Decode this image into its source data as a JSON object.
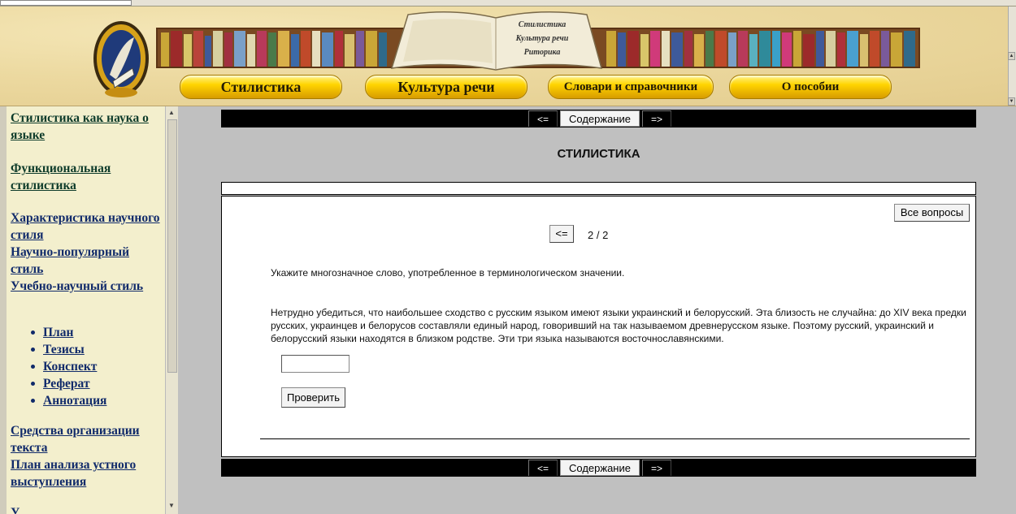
{
  "header": {
    "logo_alt": "Стилистика",
    "open_book_lines": [
      "Стилистика",
      "Культура речи",
      "Риторика"
    ],
    "nav": [
      {
        "label": "Стилистика"
      },
      {
        "label": "Культура речи"
      },
      {
        "label": "Словари и справочники"
      },
      {
        "label": "О пособии"
      }
    ]
  },
  "sidebar": {
    "links_top": [
      {
        "label": "Стилистика как наука о языке"
      },
      {
        "label": "Функциональная стилистика"
      },
      {
        "label": "Характеристика научного стиля"
      },
      {
        "label": "Научно-популярный стиль"
      },
      {
        "label": "Учебно-научный стиль"
      }
    ],
    "sublinks": [
      {
        "label": "План"
      },
      {
        "label": "Тезисы"
      },
      {
        "label": "Конспект"
      },
      {
        "label": "Реферат"
      },
      {
        "label": "Аннотация"
      }
    ],
    "links_bottom": [
      {
        "label": "Средства организации текста"
      },
      {
        "label": "План анализа устного выступления"
      }
    ]
  },
  "nav_bar": {
    "prev": "<=",
    "contents": "Содержание",
    "next": "=>"
  },
  "main": {
    "title": "СТИЛИСТИКА",
    "all_questions": "Все вопросы",
    "back": "<=",
    "counter": "2 / 2",
    "question": "Укажите многозначное слово, употребленное в терминологическом значении.",
    "passage": "Нетрудно убедиться, что наибольшее сходство с русским языком имеют языки украинский и белорусский. Эта близость не случайна: до XIV века предки русских, украинцев и белорусов составляли единый народ, говоривший на так называемом древнерусском языке. Поэтому русский, украинский и белорусский языки находятся в близком родстве. Эти три языка называются восточнославянскими.",
    "answer_value": "",
    "check": "Проверить"
  }
}
